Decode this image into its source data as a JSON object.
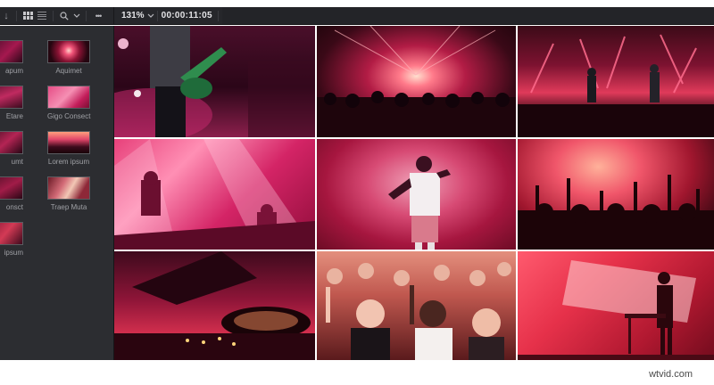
{
  "toolbar": {
    "zoom": "131%",
    "timecode": "00:00:11:05",
    "more": "•••",
    "left_arrow": "↓"
  },
  "sidebar": {
    "partial_labels": [
      "apum",
      "Etare",
      "umt",
      "onsct",
      "ipsum"
    ],
    "clips": [
      {
        "label": "Aquimet"
      },
      {
        "label": "Gigo Consect"
      },
      {
        "label": "Lorem ipsum"
      },
      {
        "label": "Traep Muta"
      }
    ]
  },
  "grid": {
    "tiles": [
      {
        "name": "guitarist-tile",
        "scene": "guitarist"
      },
      {
        "name": "stage-lights-crowd-tile",
        "scene": "stagelights"
      },
      {
        "name": "band-on-stage-tile",
        "scene": "band"
      },
      {
        "name": "dj-stage-light-tile",
        "scene": "djlights"
      },
      {
        "name": "singer-smoke-tile",
        "scene": "singer"
      },
      {
        "name": "crowd-hands-up-tile",
        "scene": "crowdhands"
      },
      {
        "name": "dj-mixer-closeup-tile",
        "scene": "mixer"
      },
      {
        "name": "cheering-crowd-tile",
        "scene": "cheering"
      },
      {
        "name": "performer-red-light-tile",
        "scene": "redperformer"
      }
    ]
  },
  "watermark": "wtvid.com",
  "colors": {
    "toolbar": "#26272b",
    "sidebar": "#2c2d31",
    "accent_magenta": "#d4246d",
    "accent_red": "#e8374b"
  }
}
